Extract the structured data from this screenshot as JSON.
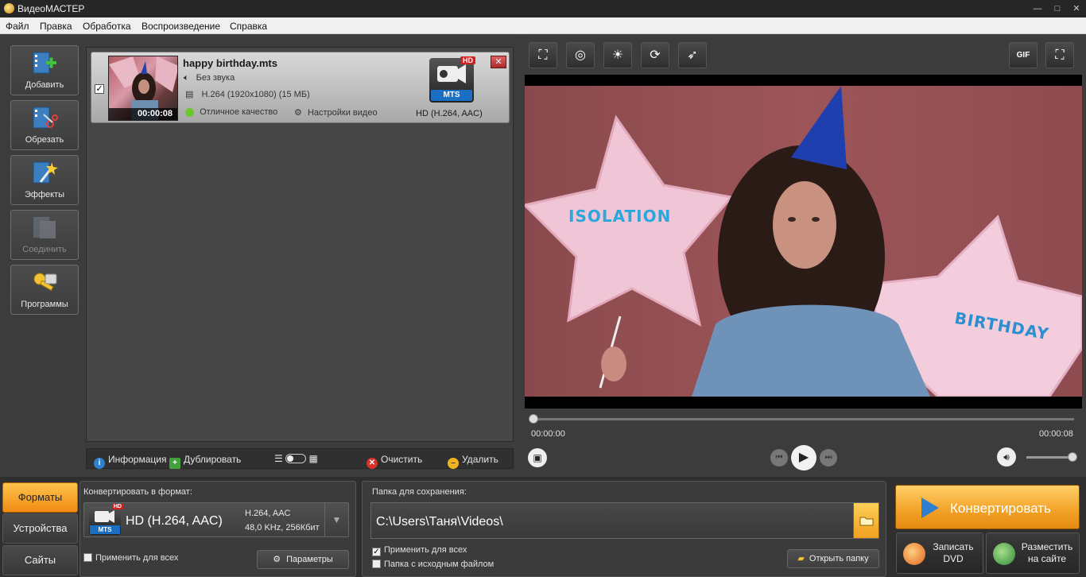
{
  "app": {
    "title": "ВидеоМАСТЕР"
  },
  "window_controls": {
    "minimize": "—",
    "maximize": "□",
    "close": "✕"
  },
  "menu": [
    "Файл",
    "Правка",
    "Обработка",
    "Воспроизведение",
    "Справка"
  ],
  "sidebar": [
    {
      "label": "Добавить",
      "icon": "film-add-icon",
      "enabled": true
    },
    {
      "label": "Обрезать",
      "icon": "film-cut-icon",
      "enabled": true
    },
    {
      "label": "Эффекты",
      "icon": "magic-wand-icon",
      "enabled": true
    },
    {
      "label": "Соединить",
      "icon": "film-join-icon",
      "enabled": false
    },
    {
      "label": "Программы",
      "icon": "keys-icon",
      "enabled": true
    }
  ],
  "file": {
    "checked": true,
    "name": "happy birthday.mts",
    "duration": "00:00:08",
    "audio": "Без звука",
    "video": "H.264 (1920x1080) (15 МБ)",
    "quality": "Отличное качество",
    "settings": "Настройки видео",
    "format_badge": "HD",
    "format_tag": "MTS",
    "format_label": "HD (H.264, AAC)",
    "close": "✕"
  },
  "list_toolbar": {
    "info": "Информация",
    "duplicate": "Дублировать",
    "clear": "Очистить",
    "delete": "Удалить"
  },
  "player": {
    "tools": [
      "crop-icon",
      "webcam-icon",
      "brightness-icon",
      "rotate-icon",
      "speed-icon"
    ],
    "gif": "GIF",
    "balloon_left": "ISOLATION",
    "balloon_right": "BIRTHDAY",
    "time_start": "00:00:00",
    "time_end": "00:00:08",
    "progress": 0,
    "volume": 1.0
  },
  "tabs": [
    {
      "label": "Форматы",
      "active": true
    },
    {
      "label": "Устройства",
      "active": false
    },
    {
      "label": "Сайты",
      "active": false
    }
  ],
  "format_panel": {
    "header": "Конвертировать в формат:",
    "badge": "HD",
    "tag": "MTS",
    "name": "HD (H.264, AAC)",
    "codec": "H.264, AAC",
    "audio": "48,0 KHz, 256Кбит",
    "apply_all": "Применить для всех",
    "params": "Параметры"
  },
  "save_panel": {
    "header": "Папка для сохранения:",
    "path": "C:\\Users\\Таня\\Videos\\",
    "apply_all": "Применить для всех",
    "source_folder": "Папка с исходным файлом",
    "open_folder": "Открыть папку"
  },
  "actions": {
    "convert": "Конвертировать",
    "dvd_line1": "Записать",
    "dvd_line2": "DVD",
    "web_line1": "Разместить",
    "web_line2": "на сайте"
  },
  "colors": {
    "accent": "#f2a126",
    "blue": "#2e7fd0",
    "dark": "#3c3c3c"
  }
}
